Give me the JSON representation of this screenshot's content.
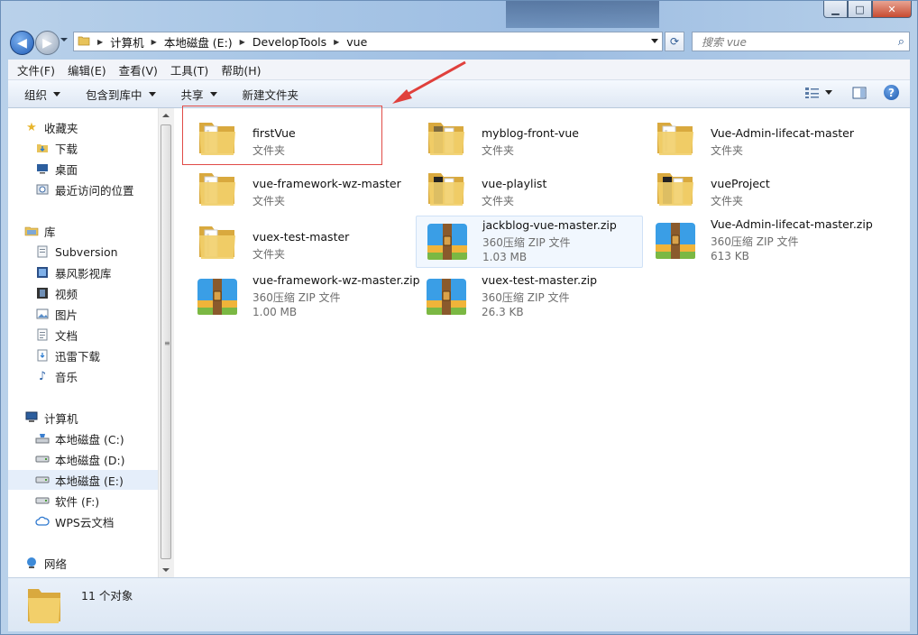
{
  "window": {
    "buttons": {
      "minimize": "▁",
      "maximize": "□",
      "close": "✕"
    }
  },
  "address": {
    "crumbs": [
      "计算机",
      "本地磁盘 (E:)",
      "DevelopTools",
      "vue"
    ]
  },
  "search": {
    "placeholder": "搜索 vue"
  },
  "menu": [
    "文件(F)",
    "编辑(E)",
    "查看(V)",
    "工具(T)",
    "帮助(H)"
  ],
  "commands": {
    "organize": "组织",
    "include_library": "包含到库中",
    "share": "共享",
    "new_folder": "新建文件夹"
  },
  "help_label": "?",
  "nav": {
    "favorites": "收藏夹",
    "downloads": "下载",
    "desktop": "桌面",
    "recent": "最近访问的位置",
    "libraries": "库",
    "subversion": "Subversion",
    "baofeng": "暴风影视库",
    "videos": "视频",
    "pictures": "图片",
    "documents": "文档",
    "xunlei": "迅雷下载",
    "music": "音乐",
    "computer": "计算机",
    "drive_c": "本地磁盘 (C:)",
    "drive_d": "本地磁盘 (D:)",
    "drive_e": "本地磁盘 (E:)",
    "drive_f": "软件 (F:)",
    "wps": "WPS云文档",
    "network": "网络"
  },
  "files": [
    {
      "name": "firstVue",
      "type": "文件夹",
      "size": ""
    },
    {
      "name": "myblog-front-vue",
      "type": "文件夹",
      "size": ""
    },
    {
      "name": "Vue-Admin-lifecat-master",
      "type": "文件夹",
      "size": ""
    },
    {
      "name": "vue-framework-wz-master",
      "type": "文件夹",
      "size": ""
    },
    {
      "name": "vue-playlist",
      "type": "文件夹",
      "size": ""
    },
    {
      "name": "vueProject",
      "type": "文件夹",
      "size": ""
    },
    {
      "name": "vuex-test-master",
      "type": "文件夹",
      "size": ""
    },
    {
      "name": "jackblog-vue-master.zip",
      "type": "360压缩 ZIP 文件",
      "size": "1.03 MB"
    },
    {
      "name": "Vue-Admin-lifecat-master.zip",
      "type": "360压缩 ZIP 文件",
      "size": "613 KB"
    },
    {
      "name": "vue-framework-wz-master.zip",
      "type": "360压缩 ZIP 文件",
      "size": "1.00 MB"
    },
    {
      "name": "vuex-test-master.zip",
      "type": "360压缩 ZIP 文件",
      "size": "26.3 KB"
    }
  ],
  "status": {
    "count": "11 个对象"
  },
  "colors": {
    "highlight_box": "#e04b47",
    "annotation_arrow": "#e0403c",
    "window_frame": "#a8c6e6"
  }
}
